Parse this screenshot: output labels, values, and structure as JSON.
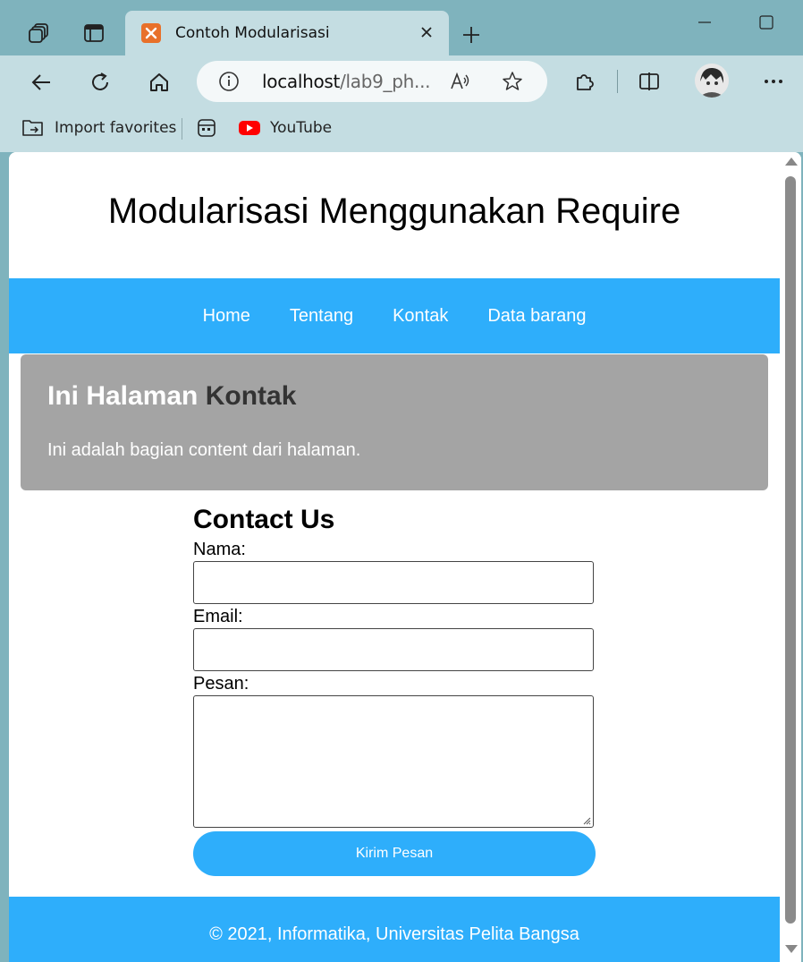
{
  "browser": {
    "tab_title": "Contoh Modularisasi",
    "address": {
      "host": "localhost",
      "path": "/lab9_ph..."
    },
    "favorites": [
      {
        "label": "Import favorites"
      },
      {
        "label": ""
      },
      {
        "label": "YouTube"
      }
    ]
  },
  "site": {
    "title": "Modularisasi Menggunakan Require",
    "nav": [
      "Home",
      "Tentang",
      "Kontak",
      "Data barang"
    ],
    "hero": {
      "heading_prefix": "Ini Halaman",
      "heading_accent": "Kontak",
      "text": "Ini adalah bagian content dari halaman."
    },
    "form": {
      "heading": "Contact Us",
      "name_label": "Nama:",
      "name_value": "",
      "email_label": "Email:",
      "email_value": "",
      "message_label": "Pesan:",
      "message_value": "",
      "submit_label": "Kirim Pesan"
    },
    "footer": "© 2021, Informatika, Universitas Pelita Bangsa"
  },
  "colors": {
    "accent": "#2eaefb",
    "hero_bg": "#a4a4a4",
    "chrome_bg": "#c4dde2",
    "tabbar_bg": "#7fb3bd"
  },
  "icons": [
    "workspaces-icon",
    "tab-actions-icon",
    "xampp-favicon",
    "close-icon",
    "plus-icon",
    "minimize-icon",
    "maximize-icon",
    "back-icon",
    "refresh-icon",
    "home-icon",
    "info-icon",
    "read-aloud-icon",
    "star-icon",
    "extensions-icon",
    "split-screen-icon",
    "avatar",
    "more-icon",
    "folder-import-icon",
    "app-icon",
    "youtube-icon"
  ]
}
